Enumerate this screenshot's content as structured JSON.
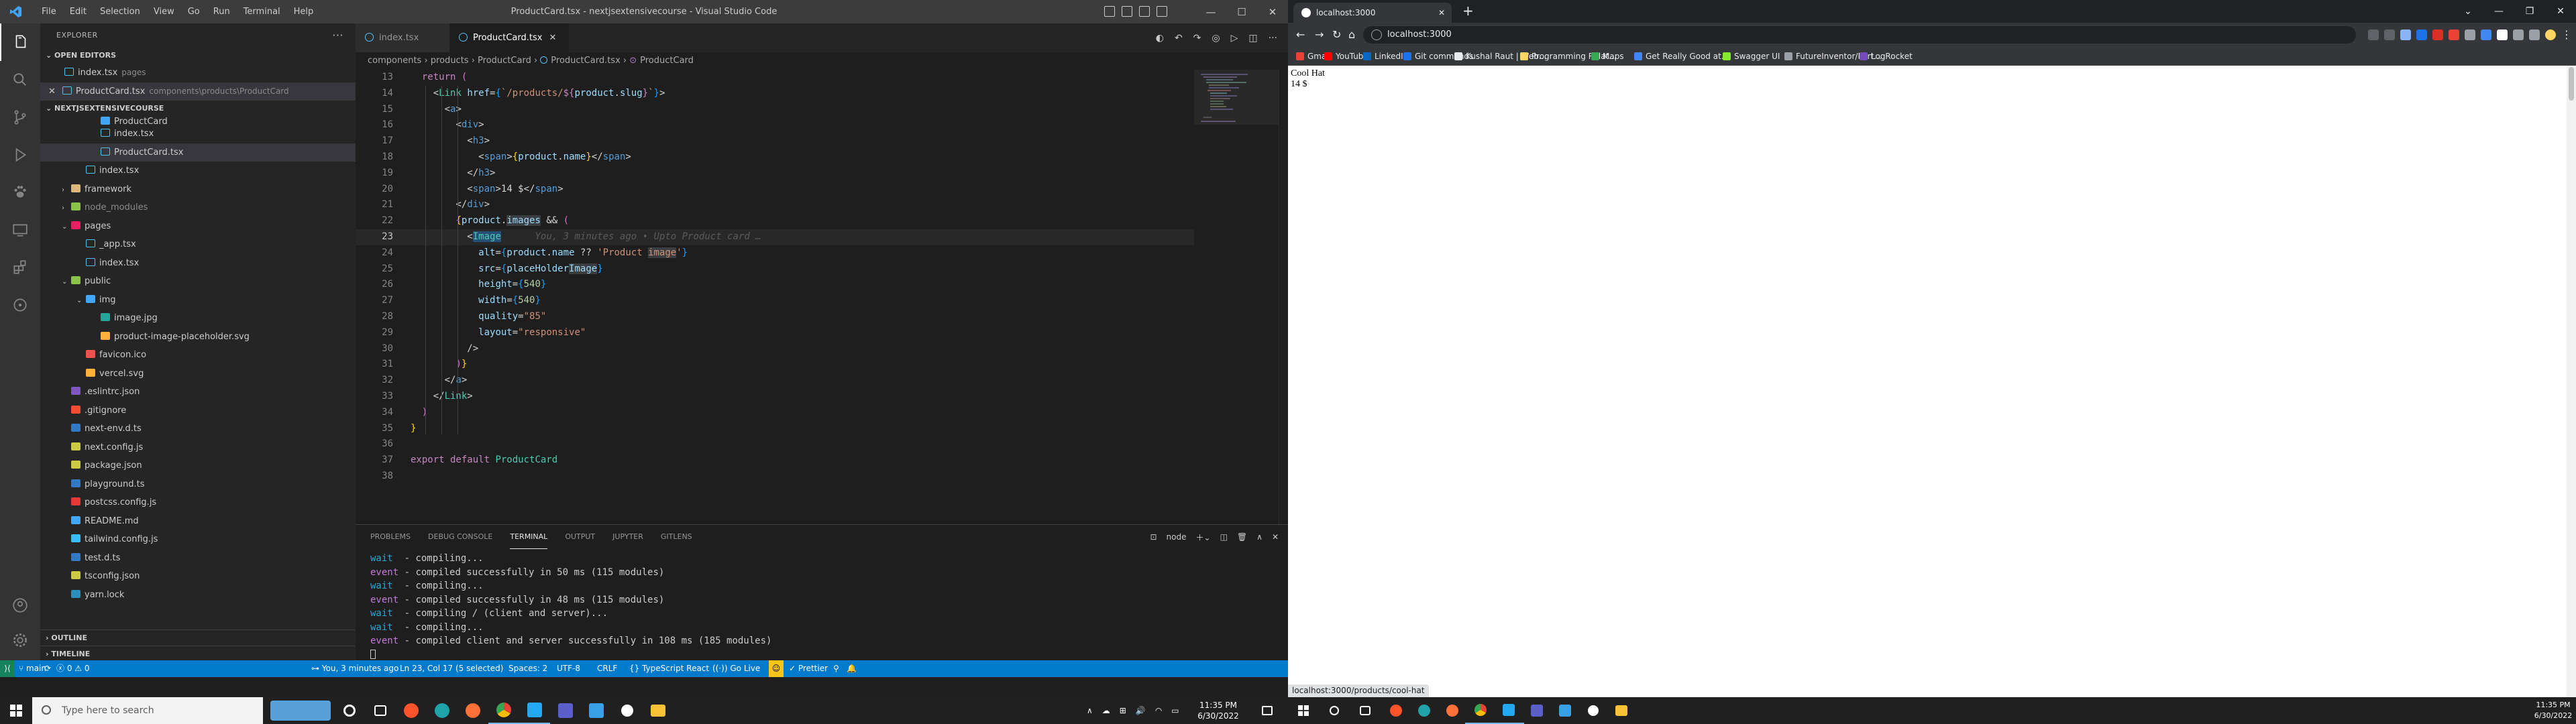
{
  "vscode": {
    "window_title": "ProductCard.tsx - nextjsextensivecourse - Visual Studio Code",
    "menu": [
      "File",
      "Edit",
      "Selection",
      "View",
      "Go",
      "Run",
      "Terminal",
      "Help"
    ],
    "sidebar": {
      "title": "EXPLORER",
      "open_editors_header": "OPEN EDITORS",
      "open_editors": [
        {
          "name": "index.tsx",
          "desc": "pages"
        },
        {
          "name": "ProductCard.tsx",
          "desc": "components\\products\\ProductCard"
        }
      ],
      "project_header": "NEXTJSEXTENSIVECOURSE",
      "tree": [
        {
          "name": "ProductCard",
          "indent": 3,
          "icon": "ic-folder-b",
          "partial": true
        },
        {
          "name": "index.tsx",
          "indent": 3,
          "icon": "ic-react"
        },
        {
          "name": "ProductCard.tsx",
          "indent": 3,
          "icon": "ic-react",
          "selected": true
        },
        {
          "name": "index.tsx",
          "indent": 2,
          "icon": "ic-react"
        },
        {
          "name": "framework",
          "indent": 1,
          "icon": "ic-folder",
          "chev": "›"
        },
        {
          "name": "node_modules",
          "indent": 1,
          "icon": "ic-folder-g",
          "chev": "›",
          "dim": true
        },
        {
          "name": "pages",
          "indent": 1,
          "icon": "ic-folder-p",
          "chev": "⌄"
        },
        {
          "name": "_app.tsx",
          "indent": 2,
          "icon": "ic-react"
        },
        {
          "name": "index.tsx",
          "indent": 2,
          "icon": "ic-react"
        },
        {
          "name": "public",
          "indent": 1,
          "icon": "ic-folder-g",
          "chev": "⌄"
        },
        {
          "name": "img",
          "indent": 2,
          "icon": "ic-folder-b",
          "chev": "⌄"
        },
        {
          "name": "image.jpg",
          "indent": 3,
          "icon": "ic-img"
        },
        {
          "name": "product-image-placeholder.svg",
          "indent": 3,
          "icon": "ic-svg"
        },
        {
          "name": "favicon.ico",
          "indent": 2,
          "icon": "ic-fav"
        },
        {
          "name": "vercel.svg",
          "indent": 2,
          "icon": "ic-svg"
        },
        {
          "name": ".eslintrc.json",
          "indent": 1,
          "icon": "ic-eslint"
        },
        {
          "name": ".gitignore",
          "indent": 1,
          "icon": "ic-git"
        },
        {
          "name": "next-env.d.ts",
          "indent": 1,
          "icon": "ic-ts"
        },
        {
          "name": "next.config.js",
          "indent": 1,
          "icon": "ic-json"
        },
        {
          "name": "package.json",
          "indent": 1,
          "icon": "ic-json"
        },
        {
          "name": "playground.ts",
          "indent": 1,
          "icon": "ic-ts"
        },
        {
          "name": "postcss.config.js",
          "indent": 1,
          "icon": "ic-post"
        },
        {
          "name": "README.md",
          "indent": 1,
          "icon": "ic-md"
        },
        {
          "name": "tailwind.config.js",
          "indent": 1,
          "icon": "ic-tw"
        },
        {
          "name": "test.d.ts",
          "indent": 1,
          "icon": "ic-ts"
        },
        {
          "name": "tsconfig.json",
          "indent": 1,
          "icon": "ic-json"
        },
        {
          "name": "yarn.lock",
          "indent": 1,
          "icon": "ic-yarn"
        }
      ],
      "outline": "OUTLINE",
      "timeline": "TIMELINE"
    },
    "tabs": [
      {
        "label": "index.tsx",
        "active": false
      },
      {
        "label": "ProductCard.tsx",
        "active": true
      }
    ],
    "breadcrumb": [
      "components",
      "products",
      "ProductCard",
      "ProductCard.tsx",
      "ProductCard"
    ],
    "code_first_line": 13,
    "current_line": 23,
    "blame_text": "You, 3 minutes ago • Upto Product card …",
    "panel": {
      "tabs": [
        "PROBLEMS",
        "DEBUG CONSOLE",
        "TERMINAL",
        "OUTPUT",
        "JUPYTER",
        "GITLENS"
      ],
      "active_tab": "TERMINAL",
      "shell": "node",
      "lines": [
        {
          "kind": "wait",
          "text": "  - compiling..."
        },
        {
          "kind": "event",
          "text": " - compiled successfully in 50 ms (115 modules)"
        },
        {
          "kind": "wait",
          "text": "  - compiling..."
        },
        {
          "kind": "event",
          "text": " - compiled successfully in 48 ms (115 modules)"
        },
        {
          "kind": "wait",
          "text": "  - compiling / (client and server)..."
        },
        {
          "kind": "wait",
          "text": "  - compiling..."
        },
        {
          "kind": "event",
          "text": " - compiled client and server successfully in 108 ms (185 modules)"
        }
      ]
    },
    "status": {
      "branch": "main",
      "errors": "0",
      "warnings": "0",
      "blame": "You, 3 minutes ago",
      "position": "Ln 23, Col 17 (5 selected)",
      "spaces": "Spaces: 2",
      "encoding": "UTF-8",
      "eol": "CRLF",
      "language": "TypeScript React",
      "golive": "Go Live",
      "prettier": "Prettier"
    }
  },
  "browser": {
    "tab_title": "localhost:3000",
    "url": "localhost:3000",
    "bookmarks": [
      "Gmail",
      "YouTube",
      "LinkedIn",
      "Git commands",
      "Kushal Raut | Web...",
      "Programming Relat...",
      "Maps",
      "Get Really Good at...",
      "Swagger UI",
      "FutureInventor/Port...",
      "LogRocket"
    ],
    "product_name": "Cool Hat",
    "product_price": "14 $",
    "status_link": "localhost:3000/products/cool-hat"
  },
  "taskbar": {
    "search_placeholder": "Type here to search",
    "time": "11:35 PM",
    "date": "6/30/2022"
  }
}
